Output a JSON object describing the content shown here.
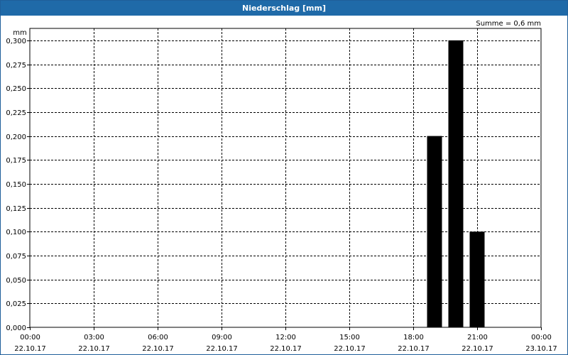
{
  "window": {
    "title": "Niederschlag [mm]"
  },
  "chart_data": {
    "type": "bar",
    "title": "Niederschlag [mm]",
    "unit": "mm",
    "sum_label": "Summe = 0,6 mm",
    "ylim": [
      0,
      0.3125
    ],
    "y_ticks": [
      "0,000",
      "0,025",
      "0,050",
      "0,075",
      "0,100",
      "0,125",
      "0,150",
      "0,175",
      "0,200",
      "0,225",
      "0,250",
      "0,275",
      "0,300"
    ],
    "y_tick_values": [
      0,
      0.025,
      0.05,
      0.075,
      0.1,
      0.125,
      0.15,
      0.175,
      0.2,
      0.225,
      0.25,
      0.275,
      0.3
    ],
    "x_range_hours": [
      0,
      24
    ],
    "x_ticks": [
      {
        "time": "00:00",
        "date": "22.10.17",
        "hour": 0
      },
      {
        "time": "03:00",
        "date": "22.10.17",
        "hour": 3
      },
      {
        "time": "06:00",
        "date": "22.10.17",
        "hour": 6
      },
      {
        "time": "09:00",
        "date": "22.10.17",
        "hour": 9
      },
      {
        "time": "12:00",
        "date": "22.10.17",
        "hour": 12
      },
      {
        "time": "15:00",
        "date": "22.10.17",
        "hour": 15
      },
      {
        "time": "18:00",
        "date": "22.10.17",
        "hour": 18
      },
      {
        "time": "21:00",
        "date": "22.10.17",
        "hour": 21
      },
      {
        "time": "00:00",
        "date": "23.10.17",
        "hour": 24
      }
    ],
    "bars": [
      {
        "hour": 19,
        "value": 0.2
      },
      {
        "hour": 20,
        "value": 0.3
      },
      {
        "hour": 21,
        "value": 0.1
      }
    ],
    "grid": true,
    "bar_color": "#000000"
  }
}
